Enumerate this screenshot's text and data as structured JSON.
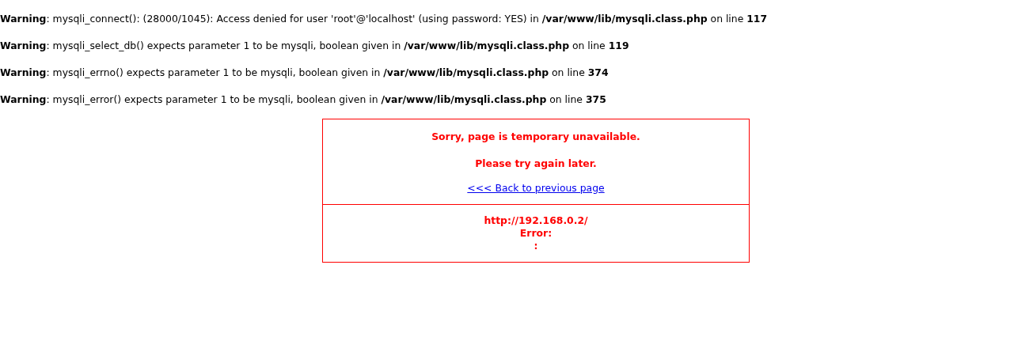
{
  "warnings": [
    {
      "text": "**Warning**: mysqli_connect(): (28000/1045): Access denied for user 'root'@'localhost' (using password: YES) in **/var/www/lib/mysqli.class.php** on line **117**"
    },
    {
      "text": "**Warning**: mysqli_select_db() expects parameter 1 to be mysqli, boolean given in **/var/www/lib/mysqli.class.php** on line **119**"
    },
    {
      "text": "**Warning**: mysqli_errno() expects parameter 1 to be mysqli, boolean given in **/var/www/lib/mysqli.class.php** on line **374**"
    },
    {
      "text": "**Warning**: mysqli_error() expects parameter 1 to be mysqli, boolean given in **/var/www/lib/mysqli.class.php** on line **375**"
    }
  ],
  "error_box": {
    "heading": "Sorry, page is temporary unavailable.",
    "message": "Please try again later.",
    "back_link": "<<< Back to previous page",
    "details": [
      "http://192.168.0.2/",
      "Error:",
      ":"
    ]
  }
}
